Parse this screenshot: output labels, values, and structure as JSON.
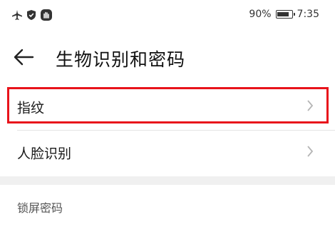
{
  "status_bar": {
    "icons": [
      "airplane-icon",
      "shield-icon",
      "hand-icon"
    ],
    "battery_percent": "90%",
    "battery_level": 0.9,
    "time": "7:35"
  },
  "header": {
    "back_icon": "arrow-left-icon",
    "title": "生物识别和密码"
  },
  "items": [
    {
      "label": "指纹",
      "chevron": "chevron-right-icon",
      "highlighted": true
    },
    {
      "label": "人脸识别",
      "chevron": "chevron-right-icon",
      "highlighted": false
    }
  ],
  "section": {
    "title": "锁屏密码"
  },
  "colors": {
    "highlight": "#e8131b",
    "chevron": "#b5b5b5",
    "section_background": "#f0f0f0"
  }
}
